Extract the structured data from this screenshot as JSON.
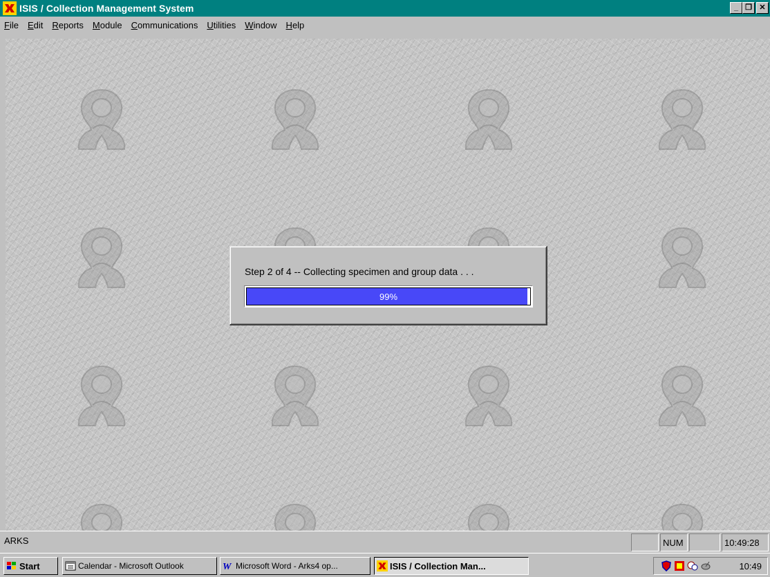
{
  "window": {
    "title": "ISIS / Collection Management System",
    "icon": "isis-app-icon",
    "controls": {
      "minimize": "_",
      "maximize": "❐",
      "close": "✕"
    }
  },
  "menu": [
    {
      "label": "File",
      "accel": "F",
      "rest": "ile"
    },
    {
      "label": "Edit",
      "accel": "E",
      "rest": "dit"
    },
    {
      "label": "Reports",
      "accel": "R",
      "rest": "eports"
    },
    {
      "label": "Module",
      "accel": "M",
      "rest": "odule"
    },
    {
      "label": "Communications",
      "accel": "C",
      "rest": "ommunications"
    },
    {
      "label": "Utilities",
      "accel": "U",
      "rest": "tilities"
    },
    {
      "label": "Window",
      "accel": "W",
      "rest": "indow"
    },
    {
      "label": "Help",
      "accel": "H",
      "rest": "elp"
    }
  ],
  "dialog": {
    "message": "Step 2 of 4 -- Collecting specimen and group data . . .",
    "progress_label": "99%",
    "progress_value": 99,
    "fill_color": "#4848f8"
  },
  "statusbar": {
    "text": "ARKS",
    "panel_num": "NUM",
    "time": "10:49:28"
  },
  "taskbar": {
    "start_label": "Start",
    "buttons": [
      {
        "label": "Calendar - Microsoft Outlook",
        "icon": "calendar-icon"
      },
      {
        "label": "Microsoft Word - Arks4 op...",
        "icon": "word-icon"
      },
      {
        "label": "ISIS / Collection Man...",
        "icon": "isis-app-icon",
        "active": true
      }
    ],
    "tray_icons": [
      "shield-icon",
      "app-tray-icon",
      "network-icon",
      "satellite-icon"
    ],
    "clock": "10:49"
  },
  "colors": {
    "titlebar": "#008080",
    "progress_fill": "#4848f8",
    "face": "#c0c0c0"
  }
}
